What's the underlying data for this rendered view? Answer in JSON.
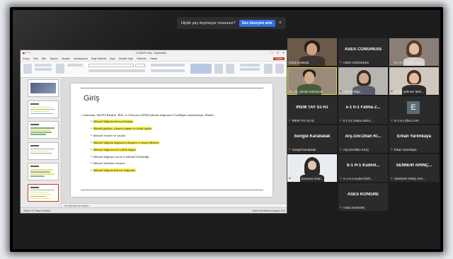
{
  "notification": {
    "text": "Hiçbir şey duymuyor musunuz?",
    "button": "Ses düzeyini artır",
    "close": "×"
  },
  "shared_screen": {
    "app_title": "2-VIMER-Giriş - Kaydedildi",
    "window_controls": [
      "–",
      "□",
      "×"
    ],
    "menu": [
      "Dosya",
      "Giriş",
      "Ekle",
      "Tasarım",
      "Geçişler",
      "Animasyonlar",
      "Slayt Gösterisi",
      "Kayıt",
      "Gözden Geçir",
      "Görünüm",
      "Yardım"
    ],
    "share_label": "Paylaş",
    "slide_count": 6,
    "selected_slide": 6,
    "slide": {
      "title": "Giriş",
      "intro": "; Lederman, Abd-El-Khalick, Bell, ve Schwartz (2002) bilimin doğasının 8 özelliğini tanımlamıştır. Bunlar;",
      "items": [
        {
          "text": "bilimsel bilginin deneysel doğası",
          "highlight": true
        },
        {
          "text": "bilimde gözlem, çıkarım yapma ve teorik ögeler",
          "highlight": true
        },
        {
          "text": "bilimsel teoriler ve yasalar",
          "highlight": false
        },
        {
          "text": "bilimsel bilginin doğasının oluşumu ve hayal edilmesi",
          "highlight": true
        },
        {
          "text": "bilimsel bilginin teori yüklü doğası",
          "highlight": true
        },
        {
          "text": "bilimsel bilginin sosyal ve kültürel birlikteliği",
          "highlight": false
        },
        {
          "text": "bilimsel metodun efsanesi",
          "highlight": false
        },
        {
          "text": "bilimsel bilginin belirsiz doğasıdır.",
          "highlight": true
        }
      ]
    },
    "notes_placeholder": "Not eklemek için tıklayın",
    "status_left": "Slayt 6 / 6   Türkçe (Türkiye)",
    "status_right": "Notlar   Görüntüleme Ayarları   %73"
  },
  "participants": [
    {
      "display": "video",
      "name": "Zühal AKMEŞE",
      "muted": false,
      "active": false
    },
    {
      "display": "ASES CONGRESS",
      "name": "ASES CONGRESS",
      "muted": true,
      "active": false
    },
    {
      "display": "video",
      "name": "S-1 H-1 MERVE EKZ...",
      "muted": true,
      "active": false
    },
    {
      "display": "video",
      "name": "S1_H1_Serdar Kahraman",
      "muted": false,
      "active": true
    },
    {
      "display": "video",
      "name": "Şükran Bilgiç",
      "muted": true,
      "active": false
    },
    {
      "display": "video",
      "name": "S1-H1 Şebnem ŞEN...",
      "muted": true,
      "active": false
    },
    {
      "display": "İREM TAY S1-h1",
      "name": "İREM TAY S1-h1",
      "muted": true,
      "active": false
    },
    {
      "display": "s-1 h-1 Fatma Z...",
      "name": "s-1 h-1 Fatma Zehra ...",
      "muted": true,
      "active": false
    },
    {
      "display": "avatar-E",
      "name": "S-1 H-1 Ebru CAN",
      "muted": true,
      "active": false
    },
    {
      "display": "Songül Karabatak",
      "name": "Songül Karabatak",
      "muted": true,
      "active": false
    },
    {
      "display": "Arş.Gör.Dilan Kl...",
      "name": "Arş.Gör.Dilan KILIÇ",
      "muted": true,
      "active": false
    },
    {
      "display": "Erkan Yarımkaya",
      "name": "Erkan Yarımkaya",
      "muted": true,
      "active": false
    },
    {
      "display": "video",
      "name": "S1 H1 Sümeyra Özde...",
      "muted": true,
      "active": false
    },
    {
      "display": "S-1 H-1 Kudret...",
      "name": "S-1 H-1 Kudret DOĞ...",
      "muted": true,
      "active": false
    },
    {
      "display": "SENNUR ARINÇ...",
      "name": "SENNUR ARINÇ AKK...",
      "muted": true,
      "active": false
    },
    {
      "display": "ASES KONGRE",
      "name": "ASES KONGRE",
      "muted": true,
      "active": false
    }
  ],
  "colors": {
    "frame_bg": "#1c1c1c",
    "tile_bg": "#2b2b2b",
    "mic_muted": "#e53935",
    "active_speaker": "#d6dd3b",
    "notif_button": "#2f6fe0",
    "slide_highlight": "#f7f04b"
  }
}
